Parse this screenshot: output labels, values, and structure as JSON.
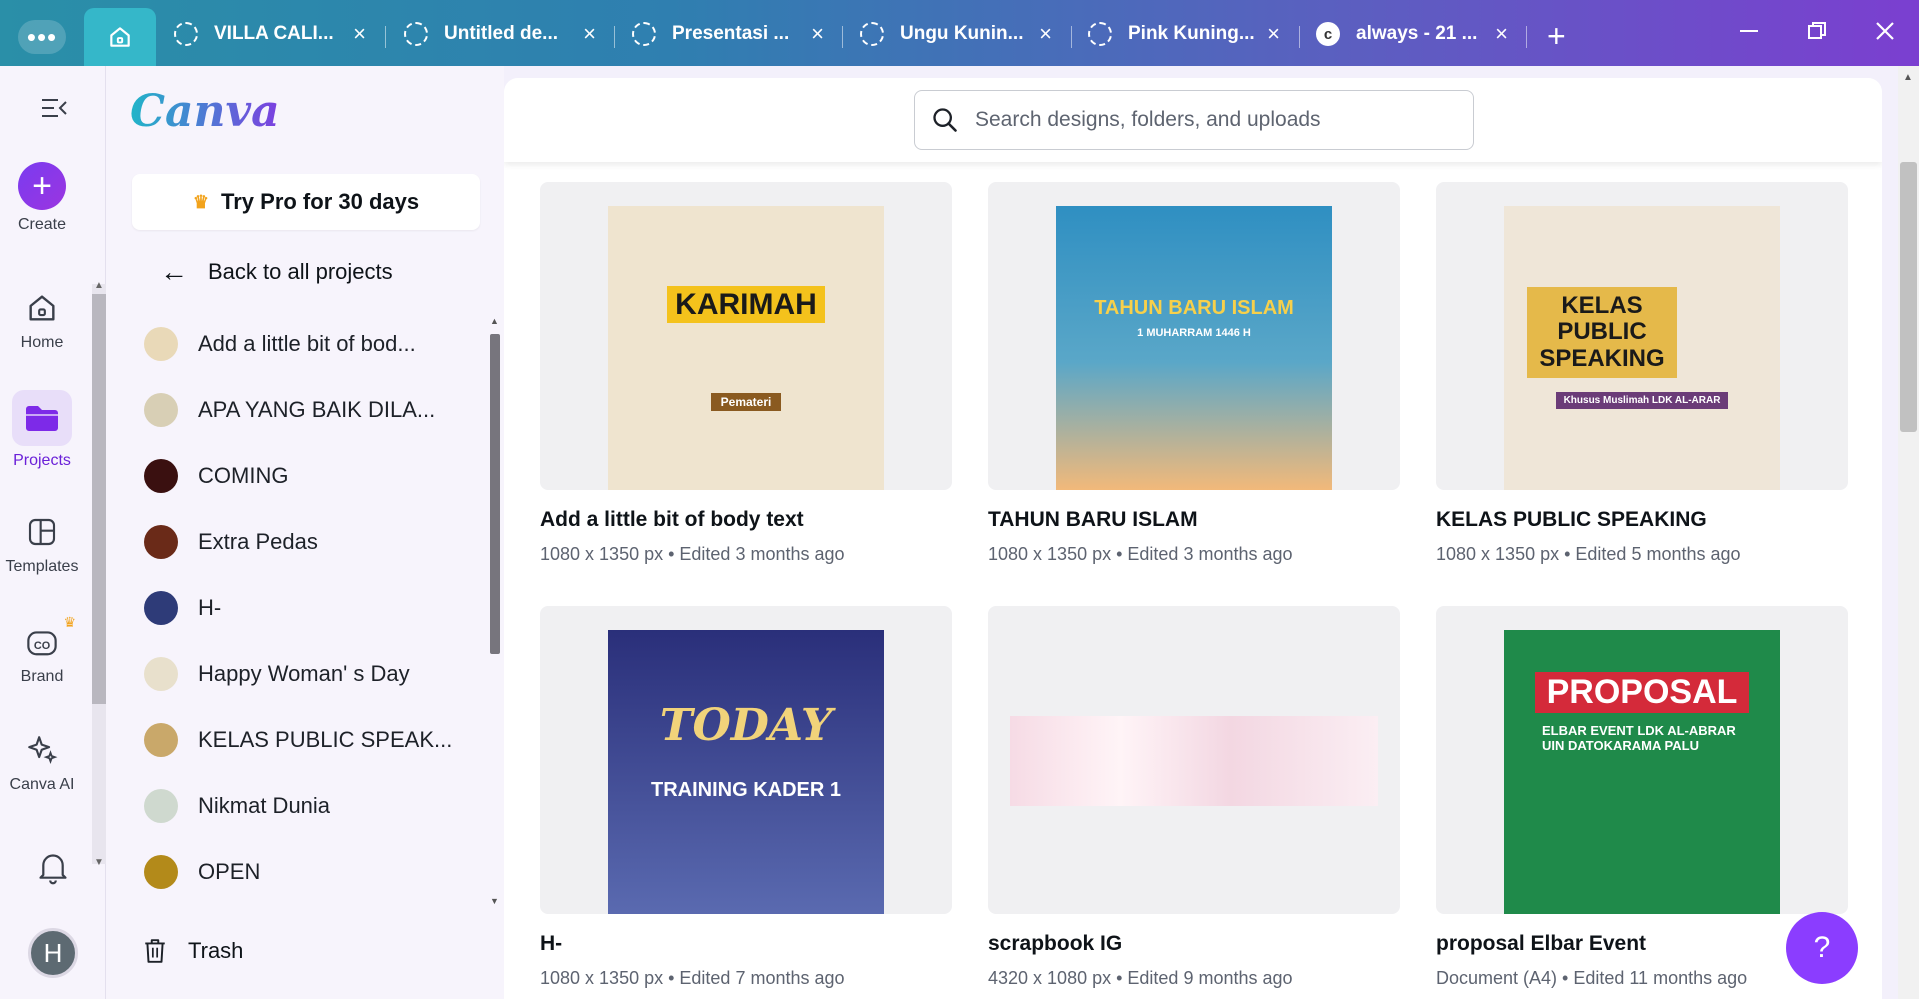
{
  "tabs": [
    {
      "label": "VILLA CALI...",
      "close": "×"
    },
    {
      "label": "Untitled de...",
      "close": "×"
    },
    {
      "label": "Presentasi ...",
      "close": "×"
    },
    {
      "label": "Ungu Kunin...",
      "close": "×"
    },
    {
      "label": "Pink Kuning...",
      "close": "×"
    },
    {
      "label": "always - 21 ...",
      "close": "×"
    }
  ],
  "new_tab": "+",
  "rail": {
    "create": "Create",
    "home": "Home",
    "projects": "Projects",
    "templates": "Templates",
    "brand": "Brand",
    "canva_ai": "Canva AI",
    "avatar": "H"
  },
  "panel": {
    "logo": "Canva",
    "try_pro": "Try Pro for 30 days",
    "back": "Back to all projects",
    "projects": [
      {
        "label": "Add a little bit of bod...",
        "color": "#e9d9b8"
      },
      {
        "label": "APA YANG BAIK DILA...",
        "color": "#d8cfb5"
      },
      {
        "label": "COMING",
        "color": "#3a1010"
      },
      {
        "label": "Extra Pedas",
        "color": "#6a2a18"
      },
      {
        "label": "H-",
        "color": "#2e3b78"
      },
      {
        "label": "Happy Woman' s Day",
        "color": "#e8e0cc"
      },
      {
        "label": "KELAS PUBLIC SPEAK...",
        "color": "#c9a86a"
      },
      {
        "label": "Nikmat Dunia",
        "color": "#cfd9cf"
      },
      {
        "label": "OPEN",
        "color": "#b38a1a"
      }
    ],
    "trash": "Trash"
  },
  "search": {
    "placeholder": "Search designs, folders, and uploads"
  },
  "designs": [
    {
      "title": "Add a little bit of body text",
      "meta": "1080 x 1350 px • Edited 3 months ago",
      "art": {
        "heading": "KARIMAH",
        "sub": "Pemateri",
        "bg": "#efe4cf",
        "fg": "#1a1a1a",
        "accent": "#f4c21c"
      }
    },
    {
      "title": "TAHUN BARU ISLAM",
      "meta": "1080 x 1350 px • Edited 3 months ago",
      "art": {
        "heading": "TAHUN BARU ISLAM",
        "sub": "1 MUHARRAM 1446 H",
        "bg": "#3f8fc0",
        "fg": "#f7d04a",
        "accent": "#f4b86a"
      }
    },
    {
      "title": "KELAS PUBLIC SPEAKING",
      "meta": "1080 x 1350 px • Edited 5 months ago",
      "art": {
        "heading": "KELAS PUBLIC SPEAKING",
        "sub": "Khusus Muslimah LDK AL-ARAR",
        "bg": "#efe6d8",
        "fg": "#1a1a1a",
        "accent": "#6b3c78"
      }
    },
    {
      "title": "H-",
      "meta": "1080 x 1350 px • Edited 7 months ago",
      "art": {
        "heading": "TODAY",
        "sub": "TRAINING KADER 1",
        "bg": "#3b3f8e",
        "fg": "#f1d37a",
        "accent": "#f4b82c"
      }
    },
    {
      "title": "scrapbook IG",
      "meta": "4320 x 1080 px • Edited 9 months ago",
      "art": {
        "heading": "",
        "sub": "",
        "bg": "#f6e4ea",
        "fg": "#1a1a1a",
        "accent": "#e07a95"
      }
    },
    {
      "title": "proposal Elbar Event",
      "meta": "Document (A4) • Edited 11 months ago",
      "art": {
        "heading": "PROPOSAL",
        "sub": "ELBAR EVENT LDK AL-ABRAR UIN DATOKARAMA PALU",
        "bg": "#1f8a4a",
        "fg": "#ffffff",
        "accent": "#d42a3a"
      }
    }
  ],
  "help": "?"
}
